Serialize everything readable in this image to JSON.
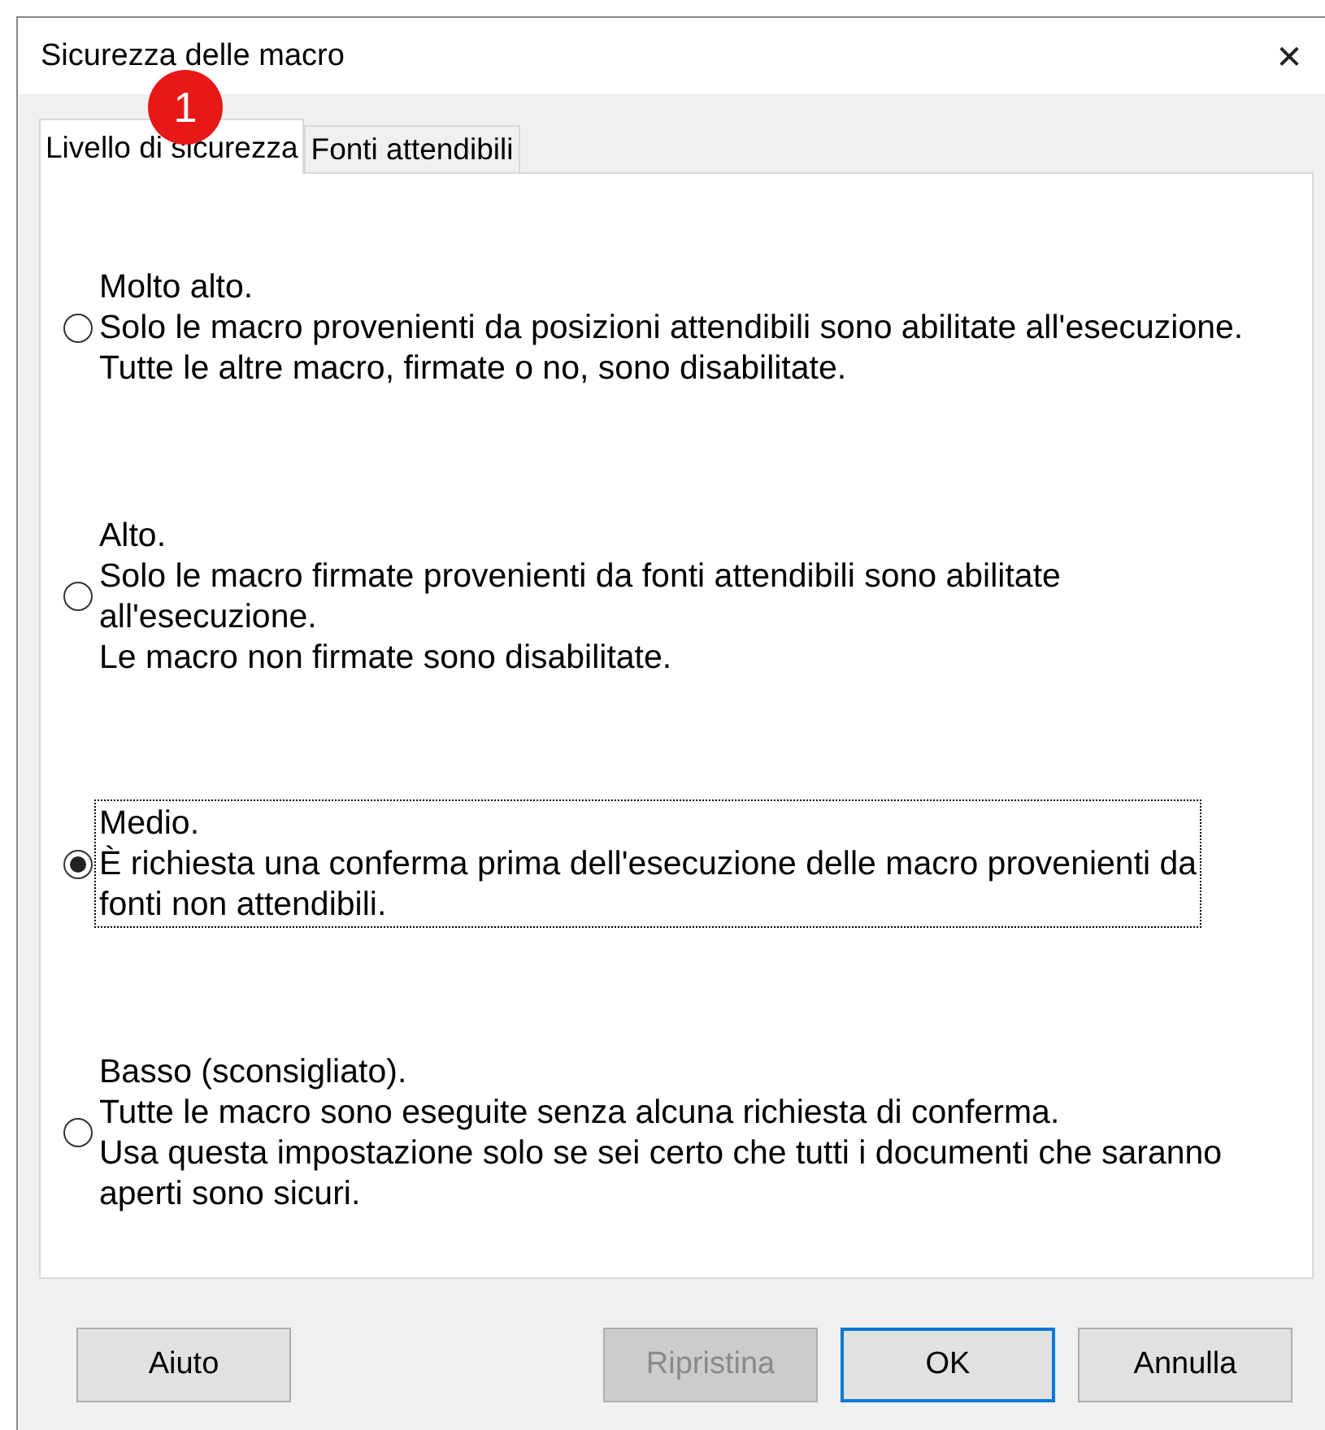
{
  "window": {
    "title": "Sicurezza delle macro",
    "close": "✕"
  },
  "badge": "1",
  "tabs": [
    {
      "label": "Livello di sicurezza",
      "selected": true
    },
    {
      "label": "Fonti attendibili",
      "selected": false
    }
  ],
  "options": [
    {
      "title": "Molto alto.",
      "lines": [
        "Solo le macro provenienti da posizioni attendibili sono abilitate all'esecuzione.",
        "Tutte le altre macro, firmate o no, sono disabilitate."
      ],
      "selected": false,
      "focused": false
    },
    {
      "title": "Alto.",
      "lines": [
        "Solo le macro firmate provenienti da fonti attendibili sono abilitate",
        "all'esecuzione.",
        "Le macro non firmate sono disabilitate."
      ],
      "selected": false,
      "focused": false
    },
    {
      "title": "Medio.",
      "lines": [
        "È richiesta una conferma prima dell'esecuzione delle macro provenienti da",
        "fonti non attendibili."
      ],
      "selected": true,
      "focused": true
    },
    {
      "title": "Basso (sconsigliato).",
      "lines": [
        "Tutte le macro sono eseguite senza alcuna richiesta di conferma.",
        "Usa questa impostazione solo se sei certo che tutti i documenti che saranno",
        "aperti sono sicuri."
      ],
      "selected": false,
      "focused": false
    }
  ],
  "help_button": {
    "label": "Aiuto"
  },
  "buttons": [
    {
      "label": "Ripristina",
      "disabled": true,
      "default": false
    },
    {
      "label": "OK",
      "disabled": false,
      "default": true
    },
    {
      "label": "Annulla",
      "disabled": false,
      "default": false
    }
  ]
}
